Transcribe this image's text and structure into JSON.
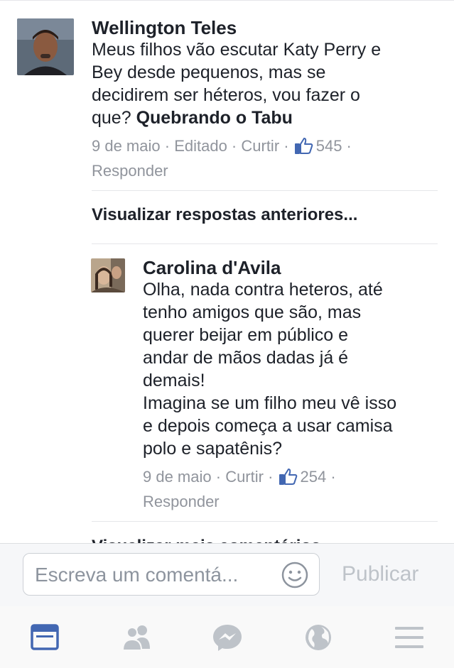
{
  "comments": [
    {
      "author": "Wellington Teles",
      "text_lines": [
        "Meus filhos vão escutar Katy Perry e",
        "Bey desde pequenos, mas se",
        "decidirem ser héteros, vou fazer o"
      ],
      "last_line_prefix": "que? ",
      "mention": "Quebrando o Tabu",
      "date": "9 de maio",
      "edited": "Editado",
      "like": "Curtir",
      "likes_count": "545",
      "reply": "Responder"
    },
    {
      "author": "Carolina d'Avila",
      "text_lines": [
        "Olha, nada contra heteros, até",
        "tenho amigos que são, mas",
        "querer beijar em público e",
        "andar de mãos dadas já é",
        "demais!",
        "Imagina se um filho meu vê isso",
        "e depois começa a usar camisa",
        "polo e sapatênis?"
      ],
      "date": "9 de maio",
      "like": "Curtir",
      "likes_count": "254",
      "reply": "Responder"
    }
  ],
  "view_previous_replies": "Visualizar respostas anteriores...",
  "cutoff_text": "Visualizar mais comentários",
  "composer": {
    "placeholder": "Escreva um comentá...",
    "publish": "Publicar",
    "emoji_icon": "smiley-icon"
  },
  "tabbar": {
    "items": [
      "news-feed-icon",
      "friends-icon",
      "messenger-icon",
      "globe-icon",
      "menu-icon"
    ],
    "active_color": "#4267b2",
    "inactive_color": "#bec3c9"
  },
  "colors": {
    "text": "#1d2129",
    "meta": "#90949c",
    "like_icon": "#4267b2"
  }
}
